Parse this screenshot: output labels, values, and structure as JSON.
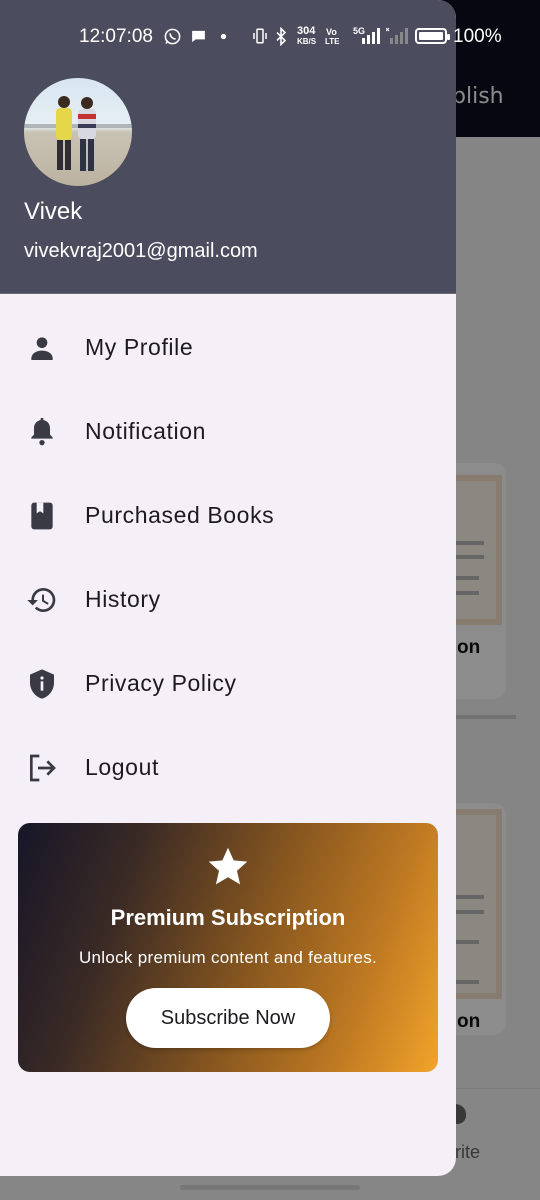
{
  "status_bar": {
    "time": "12:07:08",
    "speed_value": "304",
    "speed_unit": "KB/S",
    "volte_top": "Vo",
    "volte_bottom": "LTE",
    "network": "5G",
    "battery_percent": "100%"
  },
  "background": {
    "appbar_title_fragment": "blish",
    "card_title_fragment_1": "on",
    "card_title_fragment_2": "on",
    "nav_label_fragment": "rite"
  },
  "drawer": {
    "user": {
      "name": "Vivek",
      "email": "vivekvraj2001@gmail.com"
    },
    "menu": [
      {
        "label": "My Profile",
        "icon": "person-icon"
      },
      {
        "label": "Notification",
        "icon": "bell-icon"
      },
      {
        "label": "Purchased Books",
        "icon": "book-icon"
      },
      {
        "label": "History",
        "icon": "history-icon"
      },
      {
        "label": "Privacy Policy",
        "icon": "shield-info-icon"
      },
      {
        "label": "Logout",
        "icon": "logout-icon"
      }
    ],
    "premium": {
      "title": "Premium Subscription",
      "description": "Unlock premium content and features.",
      "button_label": "Subscribe Now"
    }
  },
  "colors": {
    "drawer_header": "#4b4d5e",
    "drawer_body": "#f5eff7",
    "premium_gradient_start": "#161628",
    "premium_gradient_end": "#f2a42a"
  }
}
